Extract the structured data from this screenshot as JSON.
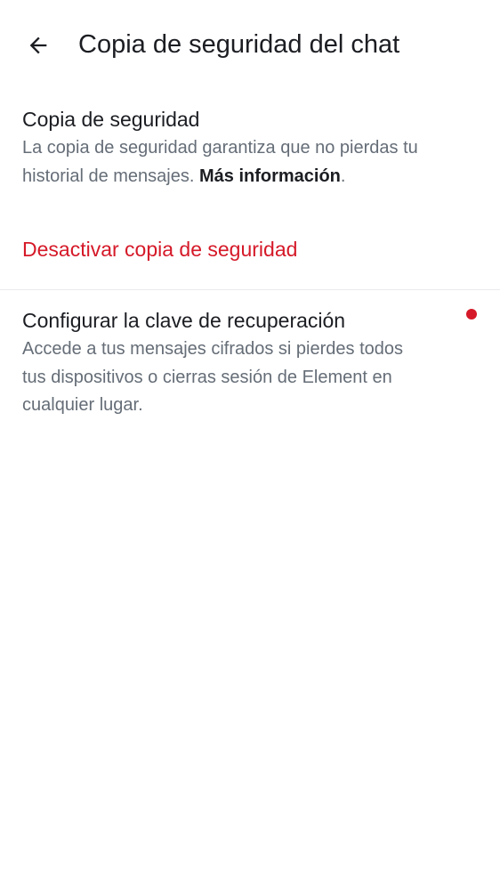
{
  "header": {
    "title": "Copia de seguridad del chat",
    "back_icon": "arrow-left-icon"
  },
  "backup": {
    "title": "Copia de seguridad",
    "description": "La copia de seguridad garantiza que no pierdas tu historial de mensajes. ",
    "link": "Más información",
    "suffix": "."
  },
  "disable_backup": {
    "label": "Desactivar copia de seguridad"
  },
  "recovery": {
    "title": "Configurar la clave de recuperación",
    "description": "Accede a tus mensajes cifrados si pierdes todos tus dispositivos o cierras sesión de Element en cualquier lugar."
  },
  "colors": {
    "accent_critical": "#d51928",
    "text_primary": "#1b1d22",
    "text_secondary": "#656d77",
    "divider": "#e8eaee"
  }
}
